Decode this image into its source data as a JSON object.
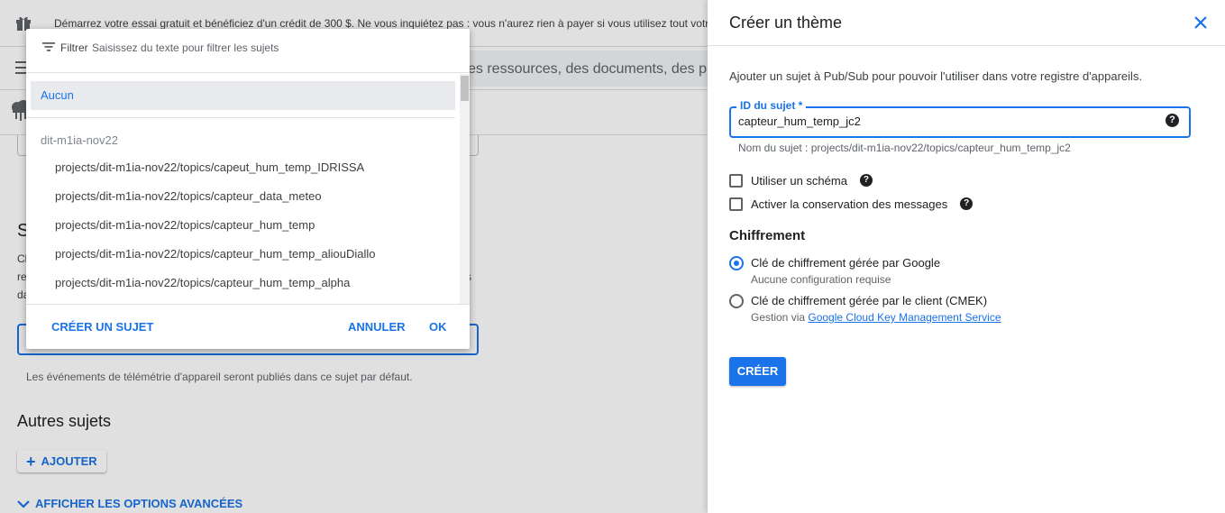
{
  "background": {
    "promo_text": "Démarrez votre essai gratuit et bénéficiez d'un crédit de 300 $. Ne vous inquiétez pas : vous n'aurez rien à payer si vous utilisez tout votre",
    "search_placeholder": "es ressources, des documents, des proc",
    "partial_heading_letter": "S",
    "partial_text_1": "Cl",
    "partial_text_2": "re",
    "partial_text_3": "da",
    "partial_text_4": "s",
    "telemetry_hint": "Les événements de télémétrie d'appareil seront publiés dans ce sujet par défaut.",
    "other_topics_heading": "Autres sujets",
    "add_button": "AJOUTER",
    "advanced_options": "AFFICHER LES OPTIONS AVANCÉES"
  },
  "dropdown": {
    "filter_label": "Filtrer",
    "filter_placeholder": "Saisissez du texte pour filtrer les sujets",
    "none_option": "Aucun",
    "group_label": "dit-m1ia-nov22",
    "topics": [
      "projects/dit-m1ia-nov22/topics/capeut_hum_temp_IDRISSA",
      "projects/dit-m1ia-nov22/topics/capteur_data_meteo",
      "projects/dit-m1ia-nov22/topics/capteur_hum_temp",
      "projects/dit-m1ia-nov22/topics/capteur_hum_temp_aliouDiallo",
      "projects/dit-m1ia-nov22/topics/capteur_hum_temp_alpha"
    ],
    "create_topic": "CRÉER UN SUJET",
    "cancel": "ANNULER",
    "ok": "OK"
  },
  "panel": {
    "title": "Créer un thème",
    "description": "Ajouter un sujet à Pub/Sub pour pouvoir l'utiliser dans votre registre d'appareils.",
    "topic_id_label": "ID du sujet *",
    "topic_id_value": "capteur_hum_temp_jc2",
    "topic_name_hint": "Nom du sujet : projects/dit-m1ia-nov22/topics/capteur_hum_temp_jc2",
    "use_schema": "Utiliser un schéma",
    "enable_retention": "Activer la conservation des messages",
    "encryption_heading": "Chiffrement",
    "google_key_label": "Clé de chiffrement gérée par Google",
    "google_key_sub": "Aucune configuration requise",
    "cmek_label": "Clé de chiffrement gérée par le client (CMEK)",
    "cmek_sub_prefix": "Gestion via",
    "cmek_link": "Google Cloud Key Management Service",
    "create_button": "CRÉER"
  },
  "colors": {
    "accent": "#1a73e8",
    "text": "#202124",
    "muted": "#5f6368"
  }
}
